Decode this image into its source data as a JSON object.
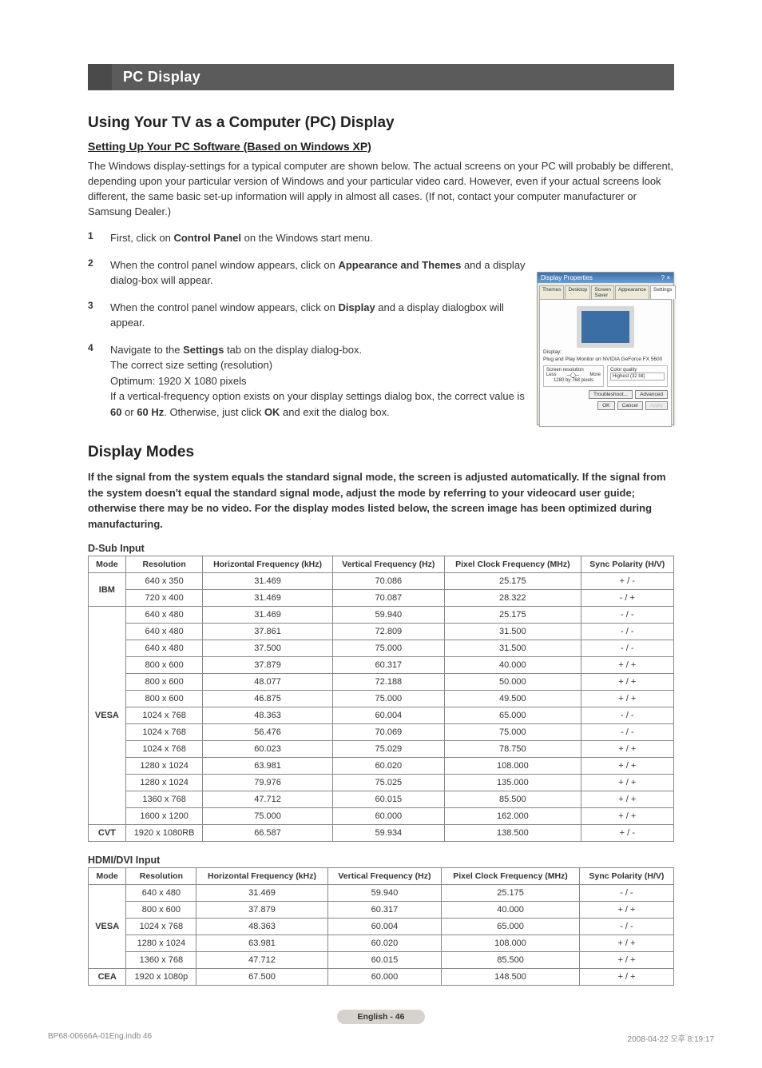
{
  "section_banner": "PC Display",
  "title": "Using Your TV as a Computer (PC) Display",
  "subtitle": "Setting Up Your PC Software (Based on Windows XP)",
  "intro_1": "The Windows display-settings for a typical computer are shown below. The actual screens on your PC will probably be different, depending upon your particular version of Windows and your particular video card. However, even if your actual screens look different, the same basic set-up information will apply in almost all cases. (If not, contact your computer manufacturer or Samsung Dealer.)",
  "step1_a": "First, click on ",
  "step1_b": "Control Panel",
  "step1_c": " on the Windows start menu.",
  "step2_a": "When the control panel window appears, click on ",
  "step2_b": "Appearance and Themes",
  "step2_c": " and a display dialog-box will appear.",
  "step3_a": "When the control panel window appears, click on ",
  "step3_b": "Display",
  "step3_c": " and a display dialogbox will appear.",
  "step4_a": "Navigate to the ",
  "step4_b": "Settings",
  "step4_c": " tab on the display dialog-box.",
  "step4_line2": "The correct size setting (resolution)",
  "step4_line3": "Optimum: 1920 X 1080 pixels",
  "step4_line4_a": "If a vertical-frequency option exists on your display settings dialog box, the correct value is ",
  "step4_line4_b": "60",
  "step4_line4_c": " or ",
  "step4_line4_d": "60 Hz",
  "step4_line4_e": ". Otherwise, just click ",
  "step4_line4_f": "OK",
  "step4_line4_g": " and exit the dialog box.",
  "dialog": {
    "title": "Display Properties",
    "tabs": [
      "Themes",
      "Desktop",
      "Screen Saver",
      "Appearance",
      "Settings"
    ],
    "display_line": "Display:",
    "display_val": "Plug and Play Monitor on NVIDIA GeForce FX 5600",
    "group1": "Screen resolution",
    "less": "Less",
    "more": "More",
    "res_val": "1280 by 768 pixels",
    "group2": "Color quality",
    "cq_val": "Highest (32 bit)",
    "troubleshoot": "Troubleshoot...",
    "advanced": "Advanced",
    "ok": "OK",
    "cancel": "Cancel",
    "apply": "Apply"
  },
  "display_modes_title": "Display Modes",
  "display_modes_note": "If the signal from the system equals the standard signal mode, the screen is adjusted automatically. If the signal from the system doesn't equal the standard signal mode, adjust the mode by referring to your videocard user guide; otherwise there may be no video. For the display modes listed below, the screen image has been optimized during manufacturing.",
  "dsub_title": "D-Sub Input",
  "headers": [
    "Mode",
    "Resolution",
    "Horizontal Frequency (kHz)",
    "Vertical Frequency (Hz)",
    "Pixel Clock Frequency (MHz)",
    "Sync Polarity (H/V)"
  ],
  "dsub_rows": [
    {
      "mode": "IBM",
      "rows": [
        [
          "640 x 350",
          "31.469",
          "70.086",
          "25.175",
          "+ / -"
        ],
        [
          "720 x 400",
          "31.469",
          "70.087",
          "28.322",
          "- / +"
        ]
      ]
    },
    {
      "mode": "VESA",
      "rows": [
        [
          "640 x 480",
          "31.469",
          "59.940",
          "25.175",
          "- / -"
        ],
        [
          "640 x 480",
          "37.861",
          "72.809",
          "31.500",
          "- / -"
        ],
        [
          "640 x 480",
          "37.500",
          "75.000",
          "31.500",
          "- / -"
        ],
        [
          "800 x 600",
          "37.879",
          "60.317",
          "40.000",
          "+ / +"
        ],
        [
          "800 x 600",
          "48.077",
          "72.188",
          "50.000",
          "+ / +"
        ],
        [
          "800 x 600",
          "46.875",
          "75.000",
          "49.500",
          "+ / +"
        ],
        [
          "1024 x 768",
          "48.363",
          "60.004",
          "65.000",
          "- / -"
        ],
        [
          "1024 x 768",
          "56.476",
          "70.069",
          "75.000",
          "- / -"
        ],
        [
          "1024 x 768",
          "60.023",
          "75.029",
          "78.750",
          "+ / +"
        ],
        [
          "1280 x 1024",
          "63.981",
          "60.020",
          "108.000",
          "+ / +"
        ],
        [
          "1280 x 1024",
          "79.976",
          "75.025",
          "135.000",
          "+ / +"
        ],
        [
          "1360 x 768",
          "47.712",
          "60.015",
          "85.500",
          "+ / +"
        ],
        [
          "1600 x 1200",
          "75.000",
          "60.000",
          "162.000",
          "+ / +"
        ]
      ]
    },
    {
      "mode": "CVT",
      "rows": [
        [
          "1920 x 1080RB",
          "66.587",
          "59.934",
          "138.500",
          "+ / -"
        ]
      ]
    }
  ],
  "hdmi_title": "HDMI/DVI Input",
  "hdmi_rows": [
    {
      "mode": "VESA",
      "rows": [
        [
          "640 x 480",
          "31.469",
          "59.940",
          "25.175",
          "- / -"
        ],
        [
          "800 x 600",
          "37.879",
          "60.317",
          "40.000",
          "+ / +"
        ],
        [
          "1024 x 768",
          "48.363",
          "60.004",
          "65.000",
          "- / -"
        ],
        [
          "1280 x 1024",
          "63.981",
          "60.020",
          "108.000",
          "+ / +"
        ],
        [
          "1360 x 768",
          "47.712",
          "60.015",
          "85.500",
          "+ / +"
        ]
      ]
    },
    {
      "mode": "CEA",
      "rows": [
        [
          "1920 x 1080p",
          "67.500",
          "60.000",
          "148.500",
          "+ / +"
        ]
      ]
    }
  ],
  "page_badge": "English - 46",
  "footer_left": "BP68-00666A-01Eng.indb   46",
  "footer_right": "2008-04-22   오후 8:19:17"
}
